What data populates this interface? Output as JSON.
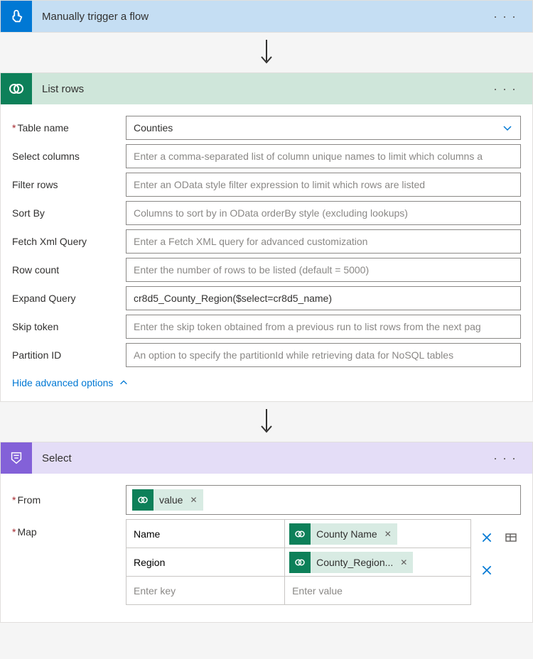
{
  "colors": {
    "trigger_tile": "#0078d4",
    "listrows_tile": "#0d8059",
    "select_tile": "#8361d8"
  },
  "trigger": {
    "title": "Manually trigger a flow"
  },
  "listrows": {
    "title": "List rows",
    "fields": {
      "table_name": {
        "label": "Table name",
        "value": "Counties"
      },
      "select_columns": {
        "label": "Select columns",
        "placeholder": "Enter a comma-separated list of column unique names to limit which columns a"
      },
      "filter_rows": {
        "label": "Filter rows",
        "placeholder": "Enter an OData style filter expression to limit which rows are listed"
      },
      "sort_by": {
        "label": "Sort By",
        "placeholder": "Columns to sort by in OData orderBy style (excluding lookups)"
      },
      "fetch_xml": {
        "label": "Fetch Xml Query",
        "placeholder": "Enter a Fetch XML query for advanced customization"
      },
      "row_count": {
        "label": "Row count",
        "placeholder": "Enter the number of rows to be listed (default = 5000)"
      },
      "expand_query": {
        "label": "Expand Query",
        "value": "cr8d5_County_Region($select=cr8d5_name)"
      },
      "skip_token": {
        "label": "Skip token",
        "placeholder": "Enter the skip token obtained from a previous run to list rows from the next pag"
      },
      "partition_id": {
        "label": "Partition ID",
        "placeholder": "An option to specify the partitionId while retrieving data for NoSQL tables"
      }
    },
    "hide_advanced": "Hide advanced options"
  },
  "select": {
    "title": "Select",
    "from_label": "From",
    "from_token": "value",
    "map_label": "Map",
    "map_rows": [
      {
        "key": "Name",
        "value_token": "County Name"
      },
      {
        "key": "Region",
        "value_token": "County_Region..."
      }
    ],
    "placeholder_key": "Enter key",
    "placeholder_value": "Enter value"
  }
}
